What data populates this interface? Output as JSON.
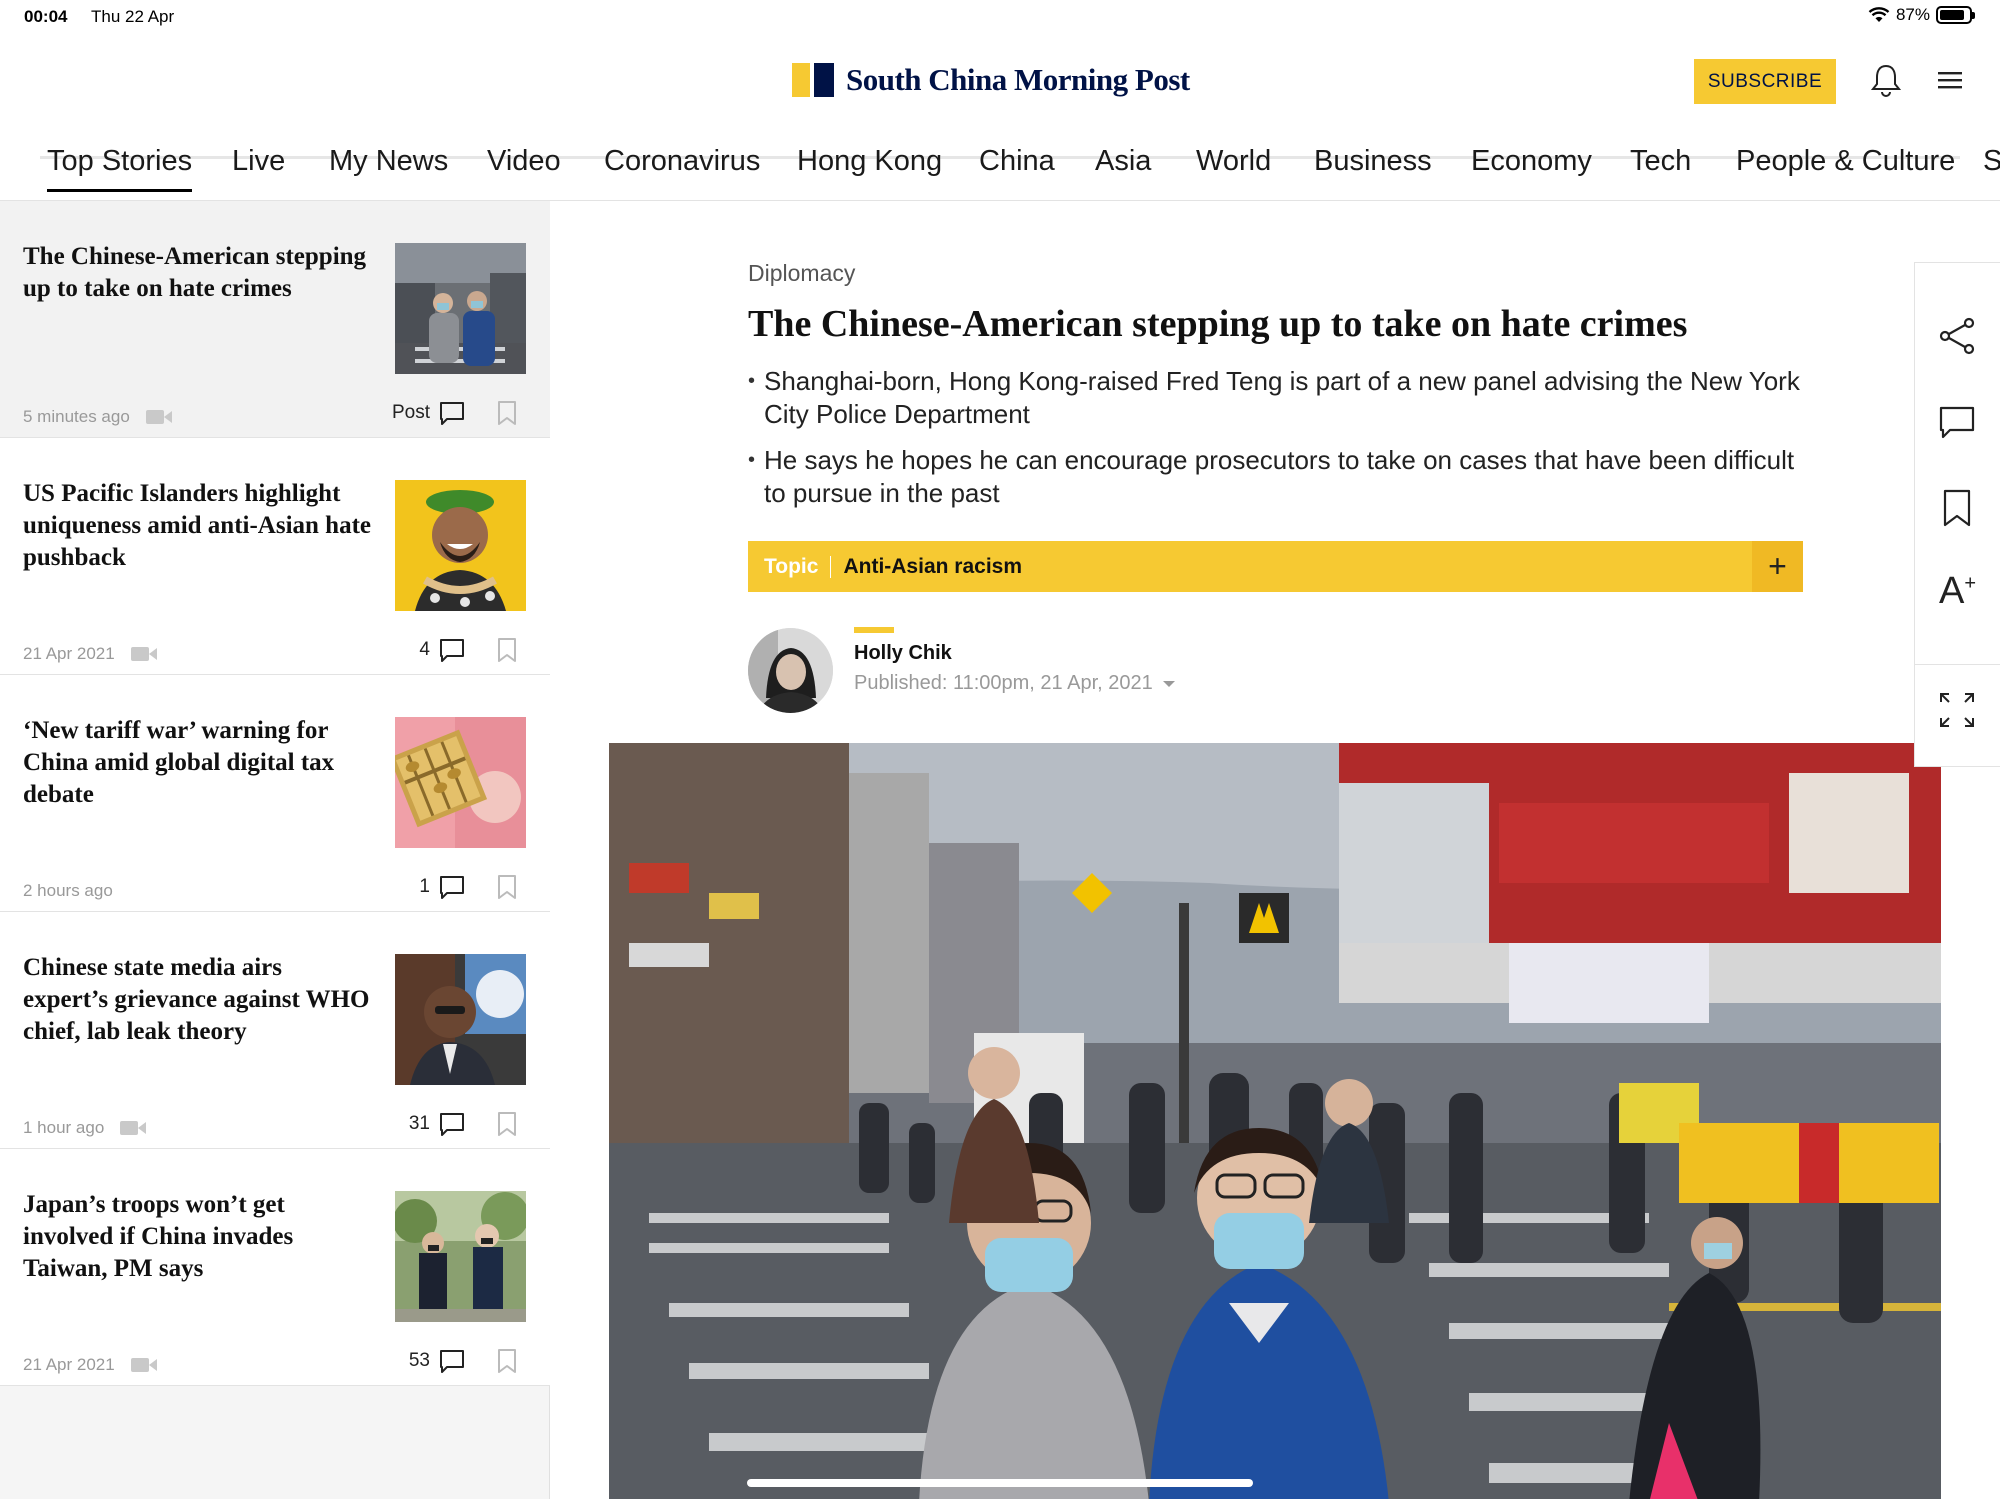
{
  "status_bar": {
    "time": "00:04",
    "date": "Thu 22 Apr",
    "battery": "87%"
  },
  "masthead": {
    "brand": "South China Morning Post",
    "subscribe_label": "SUBSCRIBE"
  },
  "nav": {
    "items": [
      "Top Stories",
      "Live",
      "My News",
      "Video",
      "Coronavirus",
      "Hong Kong",
      "China",
      "Asia",
      "World",
      "Business",
      "Economy",
      "Tech",
      "People & Culture",
      "S"
    ],
    "active": "Top Stories"
  },
  "stories": [
    {
      "title": "The Chinese-American stepping up to take on hate crimes",
      "time": "5 minutes ago",
      "comments": "Post"
    },
    {
      "title": "US Pacific Islanders highlight uniqueness amid anti-Asian hate pushback",
      "time": "21 Apr 2021",
      "comments": "4"
    },
    {
      "title": "‘New tariff war’ warning for China amid global digital tax debate",
      "time": "2 hours ago",
      "comments": "1"
    },
    {
      "title": "Chinese state media airs expert’s grievance against WHO chief, lab leak theory",
      "time": "1 hour ago",
      "comments": "31"
    },
    {
      "title": "Japan’s troops won’t get involved if China invades Taiwan, PM says",
      "time": "21 Apr 2021",
      "comments": "53"
    }
  ],
  "article": {
    "section": "Diplomacy",
    "headline": "The Chinese-American stepping up to take on hate crimes",
    "bullets": [
      "Shanghai-born, Hong Kong-raised Fred Teng is part of a new panel advising the New York City Police Department",
      "He says he hopes he can encourage prosecutors to take on cases that have been difficult to pursue in the past"
    ],
    "topic_label": "Topic",
    "topic_name": "Anti-Asian racism",
    "topic_add": "+",
    "author": "Holly Chik",
    "published": "Published: 11:00pm, 21 Apr, 2021"
  },
  "rail": {
    "font_size_label": "A"
  },
  "colors": {
    "brand_yellow": "#f6c932",
    "brand_navy": "#001246"
  }
}
